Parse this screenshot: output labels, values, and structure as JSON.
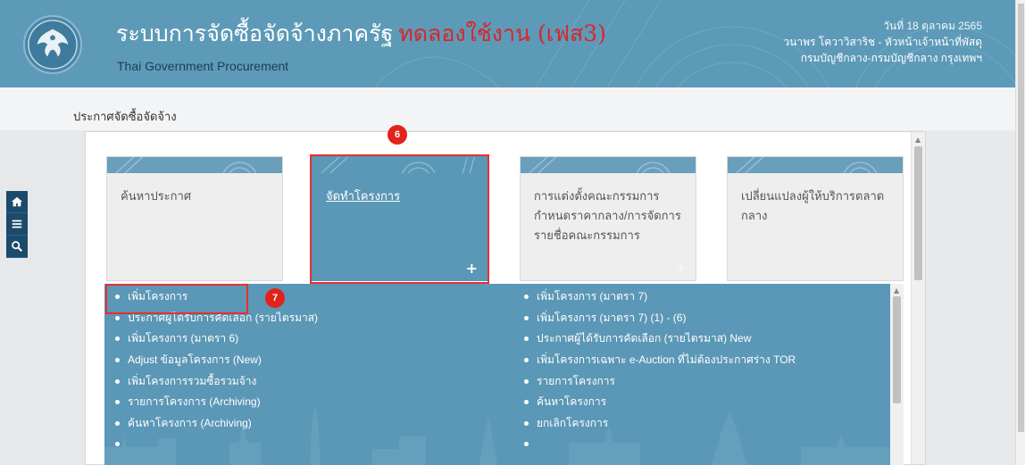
{
  "header": {
    "title": "ระบบการจัดซื้อจัดจ้างภาครัฐ",
    "title_test": "ทดลองใช้งาน (เฟส3)",
    "subtitle": "Thai Government Procurement",
    "date": "วันที่ 18 ตุลาคม 2565",
    "user": "วนาพร โควาวิสาริช - หัวหน้าเจ้าหน้าที่พัสดุ",
    "org": "กรมบัญชีกลาง-กรมบัญชีกลาง กรุงเทพฯ"
  },
  "breadcrumb": "ประกาศจัดซื้อจัดจ้าง",
  "side_nav": [
    "home-icon",
    "menu-icon",
    "search-icon"
  ],
  "cards": [
    {
      "label": "ค้นหาประกาศ",
      "active": false
    },
    {
      "label": "จัดทำโครงการ",
      "active": true
    },
    {
      "label": "การแต่งตั้งคณะกรรมการ กำหนดราคากลาง/การจัดการ รายชื่อคณะกรรมการ",
      "active": false
    },
    {
      "label": "เปลี่ยนแปลงผู้ให้บริการตลาด กลาง",
      "active": false
    }
  ],
  "submenu_left": [
    "เพิ่มโครงการ",
    "ประกาศผู้ได้รับการคัดเลือก (รายไตรมาส)",
    "เพิ่มโครงการ (มาตรา 6)",
    "Adjust ข้อมูลโครงการ (New)",
    "เพิ่มโครงการรวมซื้อรวมจ้าง",
    "รายการโครงการ (Archiving)",
    "ค้นหาโครงการ (Archiving)",
    "",
    ""
  ],
  "submenu_right": [
    "เพิ่มโครงการ (มาตรา 7)",
    "เพิ่มโครงการ (มาตรา 7) (1) - (6)",
    "ประกาศผู้ได้รับการคัดเลือก (รายไตรมาส) New",
    "เพิ่มโครงการเฉพาะ e-Auction ที่ไม่ต้องประกาศร่าง TOR",
    "รายการโครงการ",
    "ค้นหาโครงการ",
    "ยกเลิกโครงการ",
    ""
  ],
  "badges": {
    "card": "6",
    "item": "7"
  },
  "colors": {
    "header": "#5d9ab8",
    "active": "#5b97b6",
    "highlight": "#e53030"
  }
}
